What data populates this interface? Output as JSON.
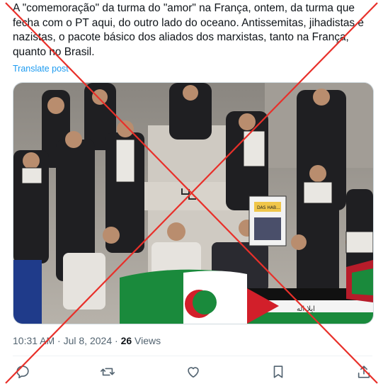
{
  "tweet": {
    "text_line1": "A \"comemoração\" da turma do \"amor\" na França, ontem, da turma que",
    "text_line2": "fecha com o PT aqui, do outro lado do oceano. Antissemitas, jihadistas e",
    "text_line3": "nazistas, o pacote básico dos aliados dos marxistas, tanto na França,",
    "text_line4": "quanto no Brasil.",
    "translate_label": "Translate post",
    "time": "10:31 AM",
    "separator": "·",
    "date": "Jul 8, 2024",
    "views_count": "26",
    "views_label": "Views"
  },
  "photo": {
    "sign_text": "DAS HAB...",
    "flag_text": "ايلا اله"
  },
  "actions": [
    {
      "name": "reply-icon"
    },
    {
      "name": "repost-icon"
    },
    {
      "name": "like-icon"
    },
    {
      "name": "bookmark-icon"
    },
    {
      "name": "share-icon"
    }
  ],
  "colors": {
    "text": "#0f1419",
    "secondary": "#536471",
    "link": "#1d9bf0",
    "overlay_x": "#e8302a"
  }
}
